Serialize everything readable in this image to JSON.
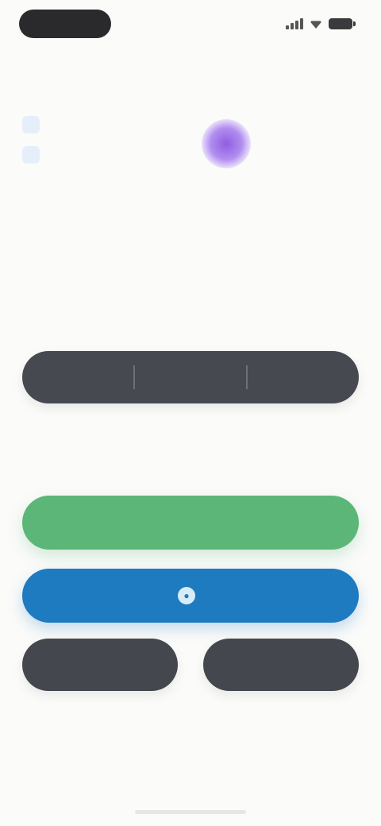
{
  "status_bar": {
    "time": "",
    "icons": [
      "signal-icon",
      "wifi-icon",
      "battery-icon"
    ]
  },
  "header": {
    "title_line1": "",
    "title_line2": "",
    "logo_icon": "brand-logo",
    "logo_color": "#9b6be8",
    "description": ""
  },
  "section": {
    "title": "",
    "text": ""
  },
  "segmented": {
    "options": [
      "",
      "",
      ""
    ]
  },
  "hint": "",
  "actions": {
    "primary_label": "",
    "primary_color": "#5bb678",
    "secondary_label": "",
    "secondary_icon": "person-icon",
    "secondary_color": "#1e7bbf",
    "left_label": "",
    "right_label": "",
    "dark_color": "#44484e"
  },
  "footer": ""
}
